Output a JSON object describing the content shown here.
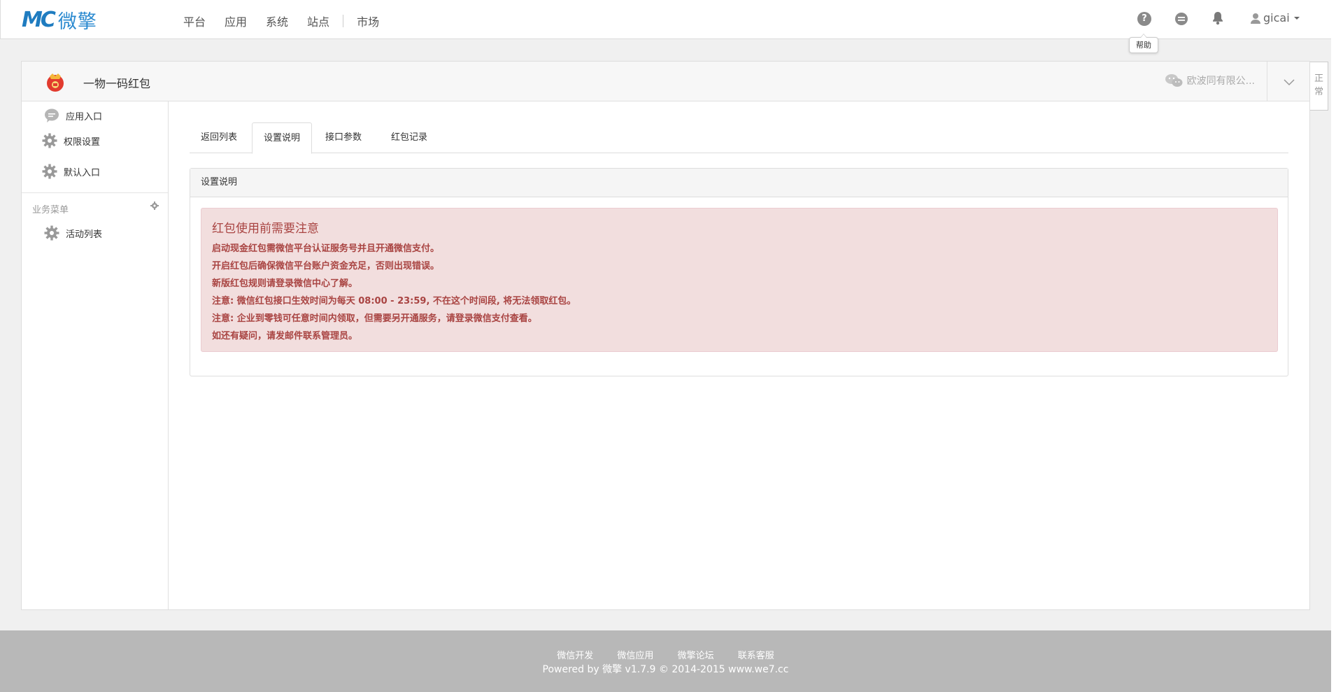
{
  "brand": {
    "mark": "MC",
    "name": "微擎"
  },
  "nav": {
    "items": [
      "平台",
      "应用",
      "系统",
      "站点",
      "市场"
    ]
  },
  "topbar": {
    "help_icon": "question-circle-icon",
    "message_icon": "comment-icon",
    "bell_icon": "bell-icon",
    "username": "gicai",
    "tooltip": "帮助"
  },
  "app": {
    "title": "一物一码红包",
    "account": "欧波同有限公...",
    "status_tab": "正常"
  },
  "sidebar": {
    "items": [
      {
        "label": "应用入口",
        "icon": "comment-icon"
      },
      {
        "label": "权限设置",
        "icon": "gear-icon"
      },
      {
        "label": "默认入口",
        "icon": "gear-icon"
      }
    ],
    "group_label": "业务菜单",
    "group_items": [
      {
        "label": "活动列表",
        "icon": "gear-icon"
      }
    ]
  },
  "tabs": [
    "返回列表",
    "设置说明",
    "接口参数",
    "红包记录"
  ],
  "box": {
    "title": "设置说明",
    "alert_title": "红包使用前需要注意",
    "alert_lines": [
      "启动现金红包需微信平台认证服务号并且开通微信支付。",
      "开启红包后确保微信平台账户资金充足，否则出现错误。",
      "新版红包规则请登录微信中心了解。",
      "注意: 微信红包接口生效时间为每天 08:00 - 23:59, 不在这个时间段, 将无法领取红包。",
      "注意: 企业到零钱可任意时间内领取，但需要另开通服务，请登录微信支付查看。",
      "如还有疑问，请发邮件联系管理员。"
    ]
  },
  "footer": {
    "links": [
      "微信开发",
      "微信应用",
      "微擎论坛",
      "联系客服"
    ],
    "copyright": "Powered by 微擎 v1.7.9 © 2014-2015 www.we7.cc"
  }
}
